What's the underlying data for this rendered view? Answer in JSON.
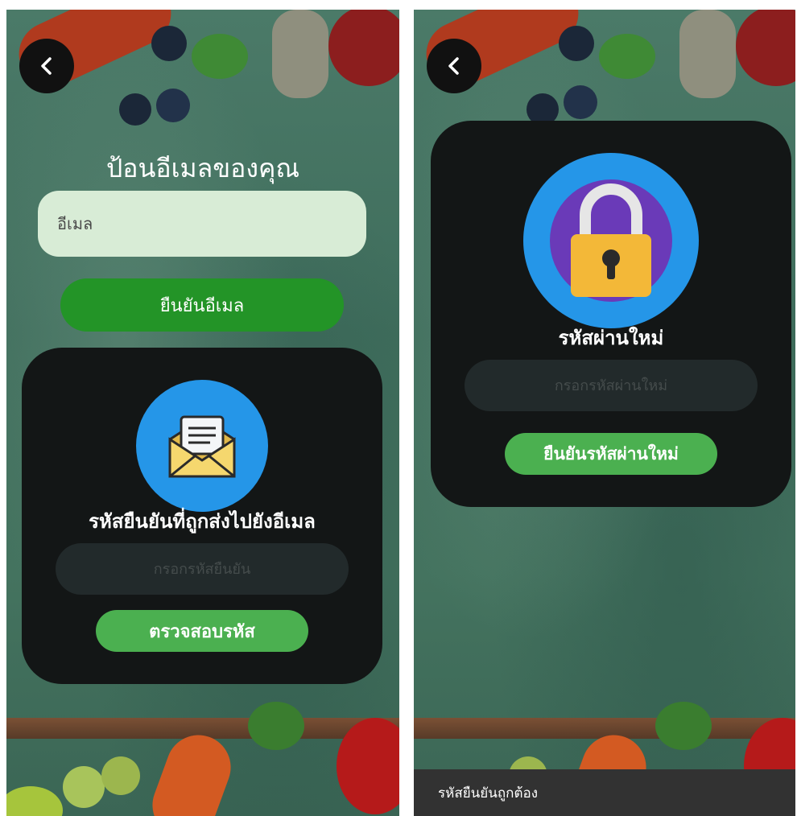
{
  "left_screen": {
    "back_icon": "chevron-left-icon",
    "title": "ป้อนอีเมลของคุณ",
    "email_input": {
      "placeholder": "อีเมล",
      "value": ""
    },
    "verify_email_button": "ยืนยันอีเมล",
    "verification_card": {
      "icon": "envelope-letter-icon",
      "title": "รหัสยืนยันที่ถูกส่งไปยังอีเมล",
      "code_input": {
        "placeholder": "กรอกรหัสยืนยัน",
        "value": ""
      },
      "check_button": "ตรวจสอบรหัส"
    }
  },
  "right_screen": {
    "back_icon": "chevron-left-icon",
    "new_password_card": {
      "icon": "padlock-icon",
      "title": "รหัสผ่านใหม่",
      "password_input": {
        "placeholder": "กรอกรหัสผ่านใหม่",
        "value": ""
      },
      "confirm_button": "ยืนยันรหัสผ่านใหม่"
    },
    "snackbar_message": "รหัสยืนยันถูกต้อง"
  },
  "colors": {
    "background_green": "#44735f",
    "card_dark": "#131616",
    "primary_green": "#239427",
    "accent_green": "#4bb050",
    "icon_blue": "#2596e8",
    "email_field": "#d8ecd6"
  }
}
